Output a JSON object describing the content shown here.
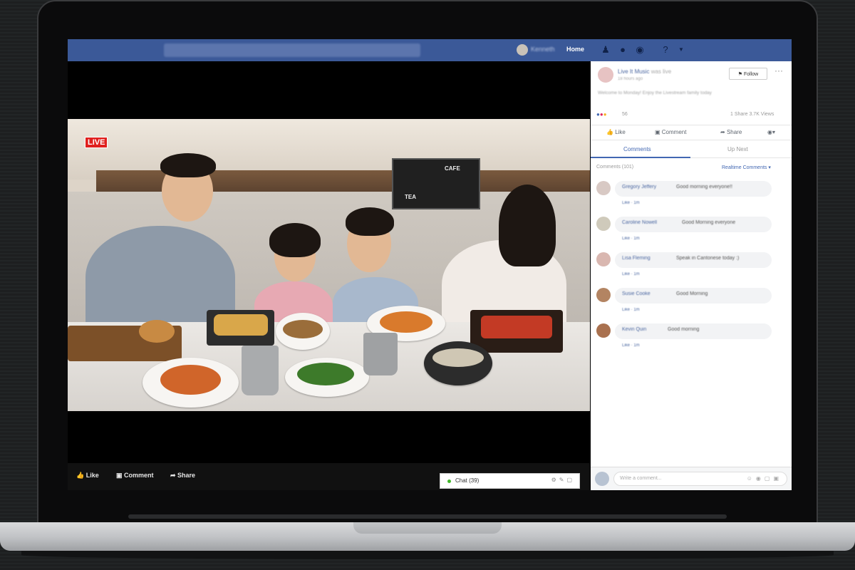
{
  "topbar": {
    "home_label": "Home",
    "user_label": "Kenneth",
    "icons": [
      "friends-icon",
      "messenger-icon",
      "globe-icon",
      "help-icon",
      "chevron-down-icon"
    ]
  },
  "video": {
    "live_label": "LIVE",
    "sign_cafe": "CAFE",
    "sign_tea": "TEA"
  },
  "video_actions": {
    "like": "Like",
    "comment": "Comment",
    "share": "Share"
  },
  "chat": {
    "label": "Chat (39)"
  },
  "post": {
    "page_name": "Live It Music",
    "live_suffix": "was live",
    "meta": "18 hours ago",
    "status": "Welcome to Monday! Enjoy the Livestream family today",
    "follow_label": "Follow",
    "reaction_count": "56",
    "shares_views": "1 Share  3.7K Views"
  },
  "post_actions": {
    "like": "Like",
    "comment": "Comment",
    "share": "Share"
  },
  "tabs": {
    "comments": "Comments",
    "up_next": "Up Next"
  },
  "comments_header": {
    "count": "Comments (101)",
    "sort": "Realtime Comments ▾"
  },
  "comments": [
    {
      "name": "Gregory Jeffery",
      "text": "Good morning everyone!!",
      "like": "Like · 1m"
    },
    {
      "name": "Caroline Nowell",
      "text": "Good Morning everyone",
      "like": "Like · 1m"
    },
    {
      "name": "Lisa Fleming",
      "text": "Speak in Cantonese today :)",
      "like": "Like · 1m"
    },
    {
      "name": "Susie Cooke",
      "text": "Good Morning",
      "like": "Like · 1m"
    },
    {
      "name": "Kevin Quin",
      "text": "Good morning",
      "like": "Like · 1m"
    }
  ],
  "composer": {
    "placeholder": "Write a comment..."
  },
  "colors": {
    "facebook_blue": "#3b5998",
    "live_red": "#e0201e",
    "link_blue": "#4267b2"
  }
}
